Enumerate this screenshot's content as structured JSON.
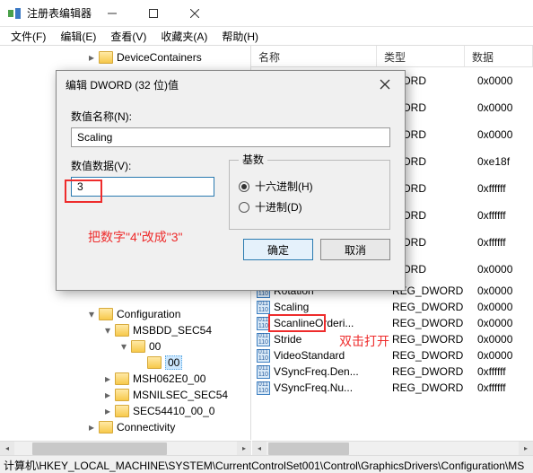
{
  "window": {
    "title": "注册表编辑器"
  },
  "menus": [
    "文件(F)",
    "编辑(E)",
    "查看(V)",
    "收藏夹(A)",
    "帮助(H)"
  ],
  "tree": {
    "top": "DeviceContainers",
    "items": [
      {
        "label": "Configuration",
        "indent": 96,
        "chev": "down",
        "sel": false
      },
      {
        "label": "MSBDD_SEC54",
        "indent": 114,
        "chev": "down",
        "sel": false
      },
      {
        "label": "00",
        "indent": 132,
        "chev": "down",
        "sel": false
      },
      {
        "label": "00",
        "indent": 150,
        "chev": "none",
        "sel": true
      },
      {
        "label": "MSH062E0_00",
        "indent": 114,
        "chev": "right",
        "sel": false
      },
      {
        "label": "MSNILSEC_SEC54",
        "indent": 114,
        "chev": "right",
        "sel": false
      },
      {
        "label": "SEC54410_00_0",
        "indent": 114,
        "chev": "right",
        "sel": false
      },
      {
        "label": "Connectivity",
        "indent": 96,
        "chev": "right",
        "sel": false
      }
    ]
  },
  "list": {
    "headers": {
      "name": "名称",
      "type": "类型",
      "data": "数据"
    },
    "rows": [
      {
        "name": "",
        "type": "WORD",
        "data": "0x0000"
      },
      {
        "name": "",
        "type": "WORD",
        "data": "0x0000"
      },
      {
        "name": "",
        "type": "WORD",
        "data": "0x0000"
      },
      {
        "name": "",
        "type": "WORD",
        "data": "0xe18f"
      },
      {
        "name": "",
        "type": "WORD",
        "data": "0xffffff"
      },
      {
        "name": "",
        "type": "WORD",
        "data": "0xffffff"
      },
      {
        "name": "",
        "type": "WORD",
        "data": "0xffffff"
      },
      {
        "name": "",
        "type": "WORD",
        "data": "0x0000"
      },
      {
        "name": "Rotation",
        "type": "REG_DWORD",
        "data": "0x0000"
      },
      {
        "name": "Scaling",
        "type": "REG_DWORD",
        "data": "0x0000"
      },
      {
        "name": "ScanlineOrderi...",
        "type": "REG_DWORD",
        "data": "0x0000"
      },
      {
        "name": "Stride",
        "type": "REG_DWORD",
        "data": "0x0000"
      },
      {
        "name": "VideoStandard",
        "type": "REG_DWORD",
        "data": "0x0000"
      },
      {
        "name": "VSyncFreq.Den...",
        "type": "REG_DWORD",
        "data": "0xffffff"
      },
      {
        "name": "VSyncFreq.Nu...",
        "type": "REG_DWORD",
        "data": "0xffffff"
      }
    ]
  },
  "statusbar": "计算机\\HKEY_LOCAL_MACHINE\\SYSTEM\\CurrentControlSet001\\Control\\GraphicsDrivers\\Configuration\\MS",
  "dialog": {
    "title": "编辑 DWORD (32 位)值",
    "name_label": "数值名称(N):",
    "name_value": "Scaling",
    "data_label": "数值数据(V):",
    "data_value": "3",
    "base_label": "基数",
    "radio_hex": "十六进制(H)",
    "radio_dec": "十进制(D)",
    "ok": "确定",
    "cancel": "取消"
  },
  "annotations": {
    "text1": "把数字\"4\"改成\"3\"",
    "text2": "双击打开"
  }
}
